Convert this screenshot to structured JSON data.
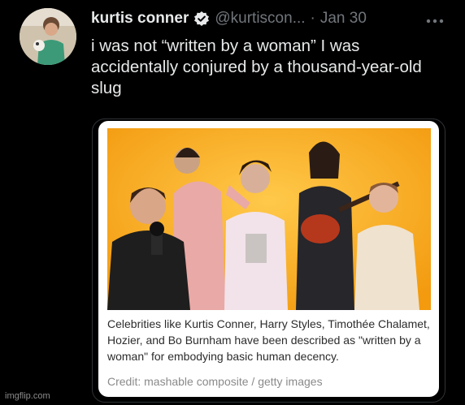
{
  "tweet": {
    "display_name": "kurtis conner",
    "handle": "@kurtiscon...",
    "separator": "·",
    "date": "Jan 30",
    "more_icon": "more-horizontal-icon",
    "verified_icon": "verified-badge-icon",
    "text": "i was not “written by a woman” I was accidentally conjured by a thousand-year-old slug"
  },
  "card": {
    "caption": "Celebrities like Kurtis Conner, Harry Styles, Timothée Chalamet, Hozier, and Bo Burnham have been described as \"written by a woman\" for embodying basic human decency.",
    "credit": "Credit: mashable composite / getty images"
  },
  "watermark": "imgflip.com",
  "colors": {
    "background": "#000000",
    "text_primary": "#e7e9ea",
    "text_secondary": "#71767b",
    "photo_background": "#f7a61a"
  }
}
